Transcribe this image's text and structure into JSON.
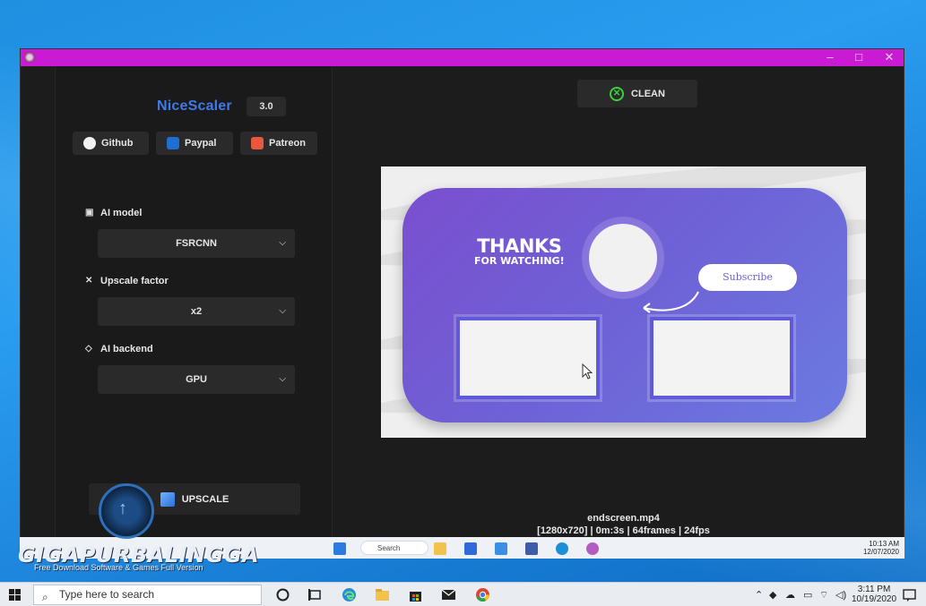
{
  "window": {
    "title_controls": {
      "minimize": "–",
      "maximize": "□",
      "close": "✕"
    }
  },
  "sidebar": {
    "brand": "NiceScaler",
    "version": "3.0",
    "links": [
      {
        "label": "Github",
        "icon": "github-icon"
      },
      {
        "label": "Paypal",
        "icon": "paypal-icon"
      },
      {
        "label": "Patreon",
        "icon": "patreon-icon"
      }
    ],
    "ai_model": {
      "label": "AI model",
      "value": "FSRCNN"
    },
    "upscale_factor": {
      "label": "Upscale factor",
      "value": "x2"
    },
    "ai_backend": {
      "label": "AI backend",
      "value": "GPU"
    },
    "upscale_button": "UPSCALE"
  },
  "main": {
    "clean_button": "CLEAN",
    "preview": {
      "thanks_line1": "THANKS",
      "thanks_line2": "FOR WATCHING!",
      "subscribe": "Subscribe"
    },
    "file_name": "endscreen.mp4",
    "file_info": "[1280x720] | 0m:3s | 64frames | 24fps"
  },
  "inner_taskbar": {
    "search": "Search",
    "time": "10:13 AM",
    "date": "12/07/2020"
  },
  "watermark": {
    "title": "GIGAPURBALINGGA",
    "subtitle": "Free Download Software & Games Full Version"
  },
  "taskbar": {
    "search_placeholder": "Type here to search",
    "time": "3:11 PM",
    "date": "10/19/2020"
  },
  "colors": {
    "titlebar": "#c81bd3",
    "brand": "#3f7ae8",
    "clean_icon": "#3ad23a",
    "card_purple": "#7a4fcf"
  }
}
